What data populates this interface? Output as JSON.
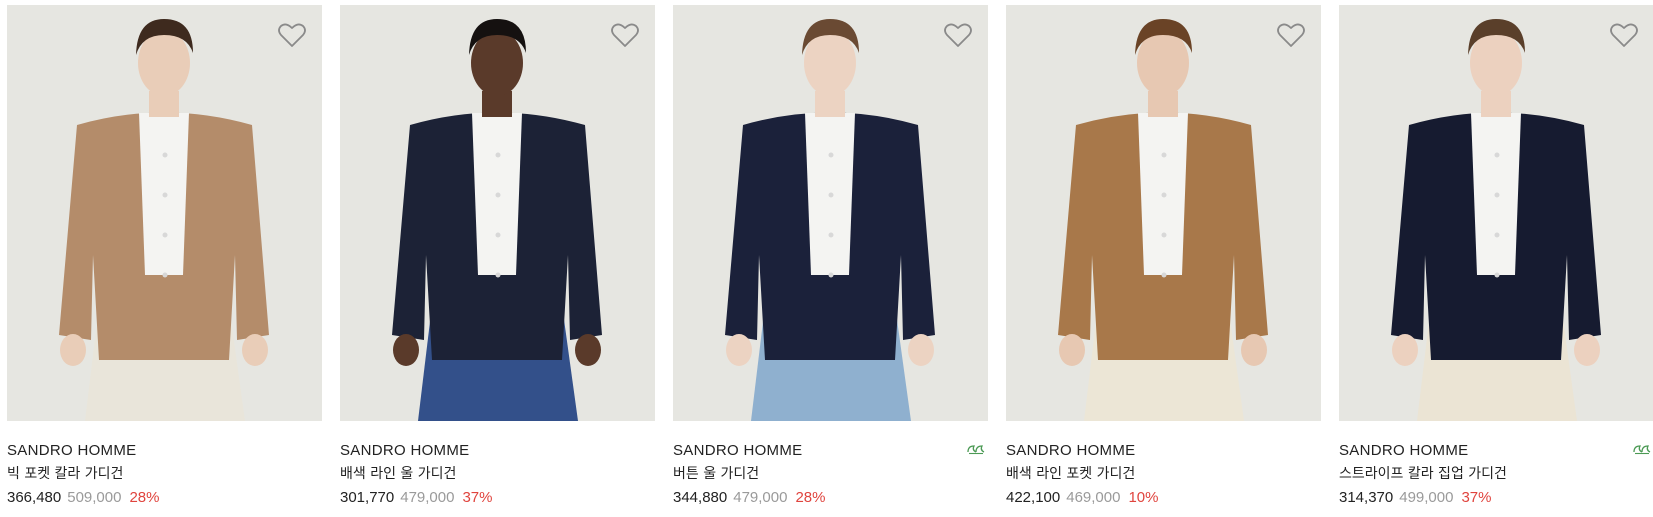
{
  "products": [
    {
      "brand": "SANDRO HOMME",
      "name": "빅 포켓 칼라 가디건",
      "price": "366,480",
      "original_price": "509,000",
      "discount": "28%",
      "eco_badge": false,
      "cardigan_color": "#b48c6a",
      "bottom_color": "#e9e5da",
      "skin_color": "#e9cdb8",
      "hair_color": "#3e2a1e"
    },
    {
      "brand": "SANDRO HOMME",
      "name": "배색 라인 울 가디건",
      "price": "301,770",
      "original_price": "479,000",
      "discount": "37%",
      "eco_badge": false,
      "cardigan_color": "#1c2236",
      "bottom_color": "#33508a",
      "skin_color": "#5a3a2a",
      "hair_color": "#151110"
    },
    {
      "brand": "SANDRO HOMME",
      "name": "버튼 울 가디건",
      "price": "344,880",
      "original_price": "479,000",
      "discount": "28%",
      "eco_badge": true,
      "cardigan_color": "#1b213a",
      "bottom_color": "#8fb0cf",
      "skin_color": "#ecd3c2",
      "hair_color": "#6a4a33"
    },
    {
      "brand": "SANDRO HOMME",
      "name": "배색 라인 포켓 가디건",
      "price": "422,100",
      "original_price": "469,000",
      "discount": "10%",
      "eco_badge": false,
      "cardigan_color": "#a8784a",
      "bottom_color": "#ece6d6",
      "skin_color": "#e7c8b2",
      "hair_color": "#6a4326"
    },
    {
      "brand": "SANDRO HOMME",
      "name": "스트라이프 칼라 집업 가디건",
      "price": "314,370",
      "original_price": "499,000",
      "discount": "37%",
      "eco_badge": true,
      "cardigan_color": "#161b30",
      "bottom_color": "#ebe4d4",
      "skin_color": "#ecd1bf",
      "hair_color": "#5a3f2a"
    }
  ],
  "colors": {
    "photo_background": "#e6e6e1",
    "discount": "#e0443e",
    "original_price": "#9a9a9a",
    "eco_badge": "#4c9a55"
  },
  "icons": {
    "wishlist": "heart-outline-icon",
    "eco": "eco-leaf-icon"
  }
}
